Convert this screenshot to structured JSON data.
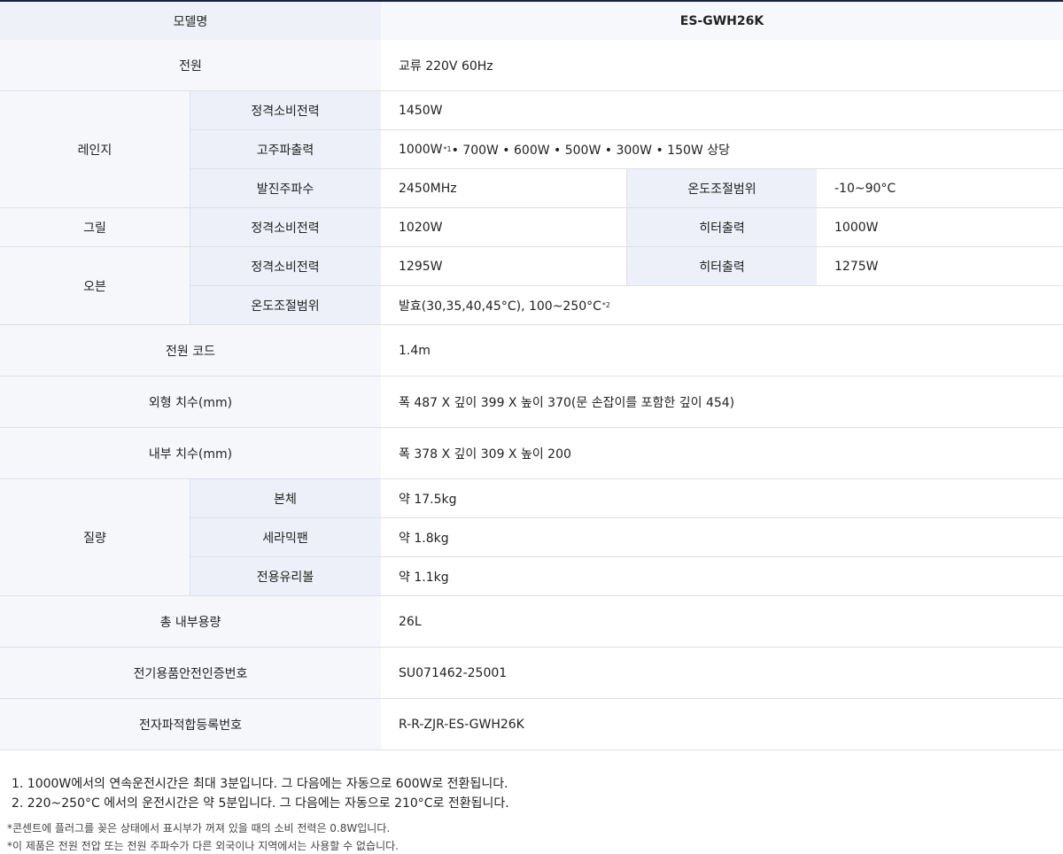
{
  "header": {
    "label": "모델명",
    "model": "ES-GWH26K"
  },
  "power": {
    "label": "전원",
    "value": "교류 220V 60Hz"
  },
  "range": {
    "label": "레인지",
    "rated_power_label": "정격소비전력",
    "rated_power_value": "1450W",
    "hf_output_label": "고주파출력",
    "hf_output_value_first": "1000W",
    "hf_output_mark": "*1",
    "hf_output_value_rest": "• 700W • 600W • 500W • 300W • 150W 상당",
    "freq_label": "발진주파수",
    "freq_value": "2450MHz",
    "temp_range_label": "온도조절범위",
    "temp_range_value": "-10~90°C"
  },
  "grill": {
    "label": "그릴",
    "rated_power_label": "정격소비전력",
    "rated_power_value": "1020W",
    "heater_label": "히터출력",
    "heater_value": "1000W"
  },
  "oven": {
    "label": "오븐",
    "rated_power_label": "정격소비전력",
    "rated_power_value": "1295W",
    "heater_label": "히터출력",
    "heater_value": "1275W",
    "temp_range_label": "온도조절범위",
    "temp_range_value": "발효(30,35,40,45°C), 100~250°C",
    "temp_range_mark": "*2"
  },
  "cord": {
    "label": "전원 코드",
    "value": "1.4m"
  },
  "outer_dim": {
    "label": "외형 치수(mm)",
    "value": "폭 487 X 깊이 399 X 높이 370(문 손잡이를 포함한 깊이 454)"
  },
  "inner_dim": {
    "label": "내부 치수(mm)",
    "value": "폭 378 X 깊이 309 X 높이 200"
  },
  "weight": {
    "label": "질량",
    "body_label": "본체",
    "body_value": "약 17.5kg",
    "ceramic_label": "세라믹팬",
    "ceramic_value": "약 1.8kg",
    "glass_label": "전용유리볼",
    "glass_value": "약 1.1kg"
  },
  "capacity": {
    "label": "총 내부용량",
    "value": "26L"
  },
  "safety_cert": {
    "label": "전기용품안전인증번호",
    "value": "SU071462-25001"
  },
  "emc_reg": {
    "label": "전자파적합등록번호",
    "value": "R-R-ZJR-ES-GWH26K"
  },
  "notes": {
    "n1": "1. 1000W에서의 연속운전시간은 최대 3분입니다. 그 다음에는 자동으로 600W로 전환됩니다.",
    "n2": "2.  220~250°C 에서의 운전시간은 약 5분입니다. 그 다음에는 자동으로 210°C로 전환됩니다.",
    "s1": "*콘센트에 플러그를 꽂은 상태에서 표시부가 꺼져 있을 때의 소비 전력은 0.8W입니다.",
    "s2": "*이 제품은 전원 전압 또는 전원 주파수가 다른 외국이나 지역에서는 사용할 수 없습니다."
  }
}
